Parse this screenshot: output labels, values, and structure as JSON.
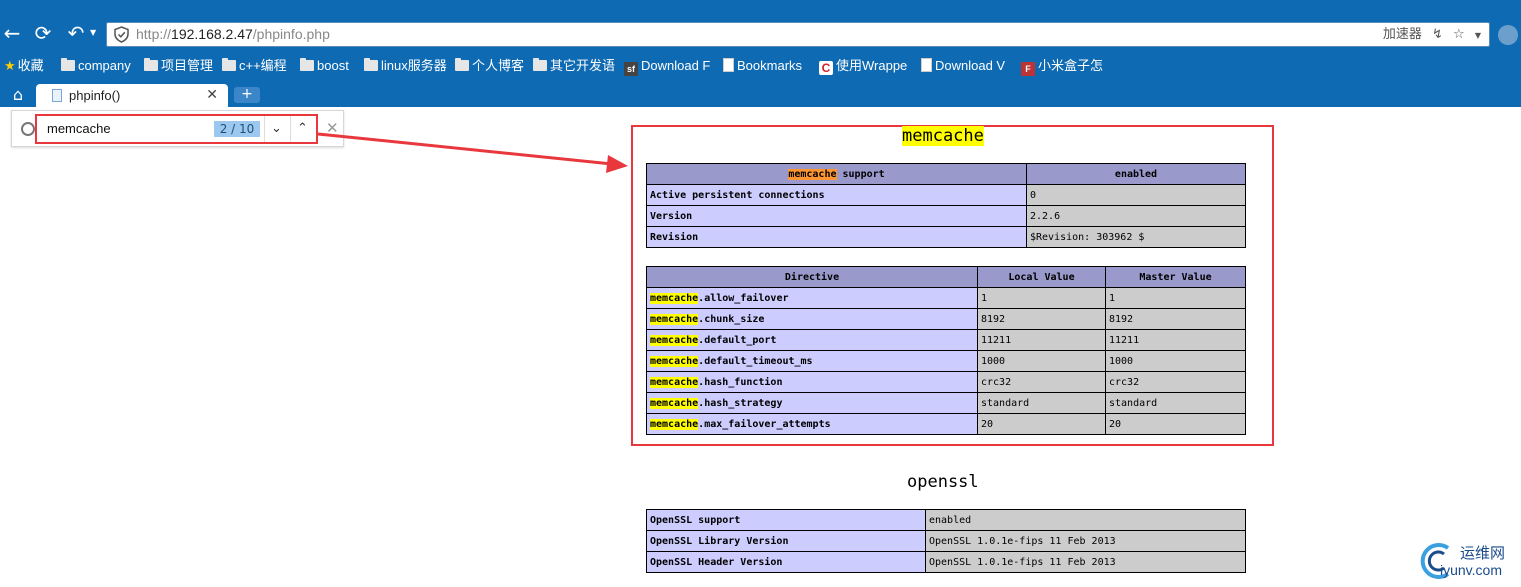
{
  "browser": {
    "url_prefix": "http://",
    "url_host": "192.168.2.47",
    "url_path": "/phpinfo.php",
    "accelerator_label": "加速器",
    "bookmarks": [
      {
        "label": "收藏",
        "icon": "star-icon"
      },
      {
        "label": "company",
        "icon": "folder-icon"
      },
      {
        "label": "项目管理",
        "icon": "folder-icon"
      },
      {
        "label": "c++编程",
        "icon": "folder-icon"
      },
      {
        "label": "boost",
        "icon": "folder-icon"
      },
      {
        "label": "linux服务器",
        "icon": "folder-icon"
      },
      {
        "label": "个人博客",
        "icon": "folder-icon"
      },
      {
        "label": "其它开发语",
        "icon": "folder-icon"
      },
      {
        "label": "Download F",
        "icon": "sf-icon"
      },
      {
        "label": "Bookmarks",
        "icon": "page-icon"
      },
      {
        "label": "使用Wrappe",
        "icon": "c-logo-icon"
      },
      {
        "label": "Download V",
        "icon": "page-icon"
      },
      {
        "label": "小米盒子怎",
        "icon": "f-logo-icon"
      }
    ],
    "tab": {
      "title": "phpinfo()"
    }
  },
  "find_bar": {
    "query": "memcache",
    "count": "2 / 10"
  },
  "memcache": {
    "title": "memcache",
    "support": {
      "header_key_hl": "memcache",
      "header_key_rest": " support",
      "header_value": "enabled",
      "rows": [
        {
          "key": "Active persistent connections",
          "value": "0"
        },
        {
          "key": "Version",
          "value": "2.2.6"
        },
        {
          "key": "Revision",
          "value": "$Revision: 303962 $"
        }
      ]
    },
    "directives": {
      "headers": [
        "Directive",
        "Local Value",
        "Master Value"
      ],
      "rows": [
        {
          "prefix": "memcache",
          "name": ".allow_failover",
          "local": "1",
          "master": "1"
        },
        {
          "prefix": "memcache",
          "name": ".chunk_size",
          "local": "8192",
          "master": "8192"
        },
        {
          "prefix": "memcache",
          "name": ".default_port",
          "local": "11211",
          "master": "11211"
        },
        {
          "prefix": "memcache",
          "name": ".default_timeout_ms",
          "local": "1000",
          "master": "1000"
        },
        {
          "prefix": "memcache",
          "name": ".hash_function",
          "local": "crc32",
          "master": "crc32"
        },
        {
          "prefix": "memcache",
          "name": ".hash_strategy",
          "local": "standard",
          "master": "standard"
        },
        {
          "prefix": "memcache",
          "name": ".max_failover_attempts",
          "local": "20",
          "master": "20"
        }
      ]
    }
  },
  "openssl": {
    "title": "openssl",
    "rows": [
      {
        "key": "OpenSSL support",
        "value": "enabled"
      },
      {
        "key": "OpenSSL Library Version",
        "value": "OpenSSL 1.0.1e-fips 11 Feb 2013"
      },
      {
        "key": "OpenSSL Header Version",
        "value": "OpenSSL 1.0.1e-fips 11 Feb 2013"
      }
    ]
  },
  "watermark": {
    "line1": "运维网",
    "line2": "iyunv.com"
  },
  "colors": {
    "chrome_blue": "#0e6ab3",
    "php_header": "#9999cc",
    "php_key": "#ccccff",
    "php_value": "#cccccc",
    "annotation_red": "#e8383d",
    "highlight_yellow": "#ffff00",
    "highlight_current": "#ff9632"
  }
}
